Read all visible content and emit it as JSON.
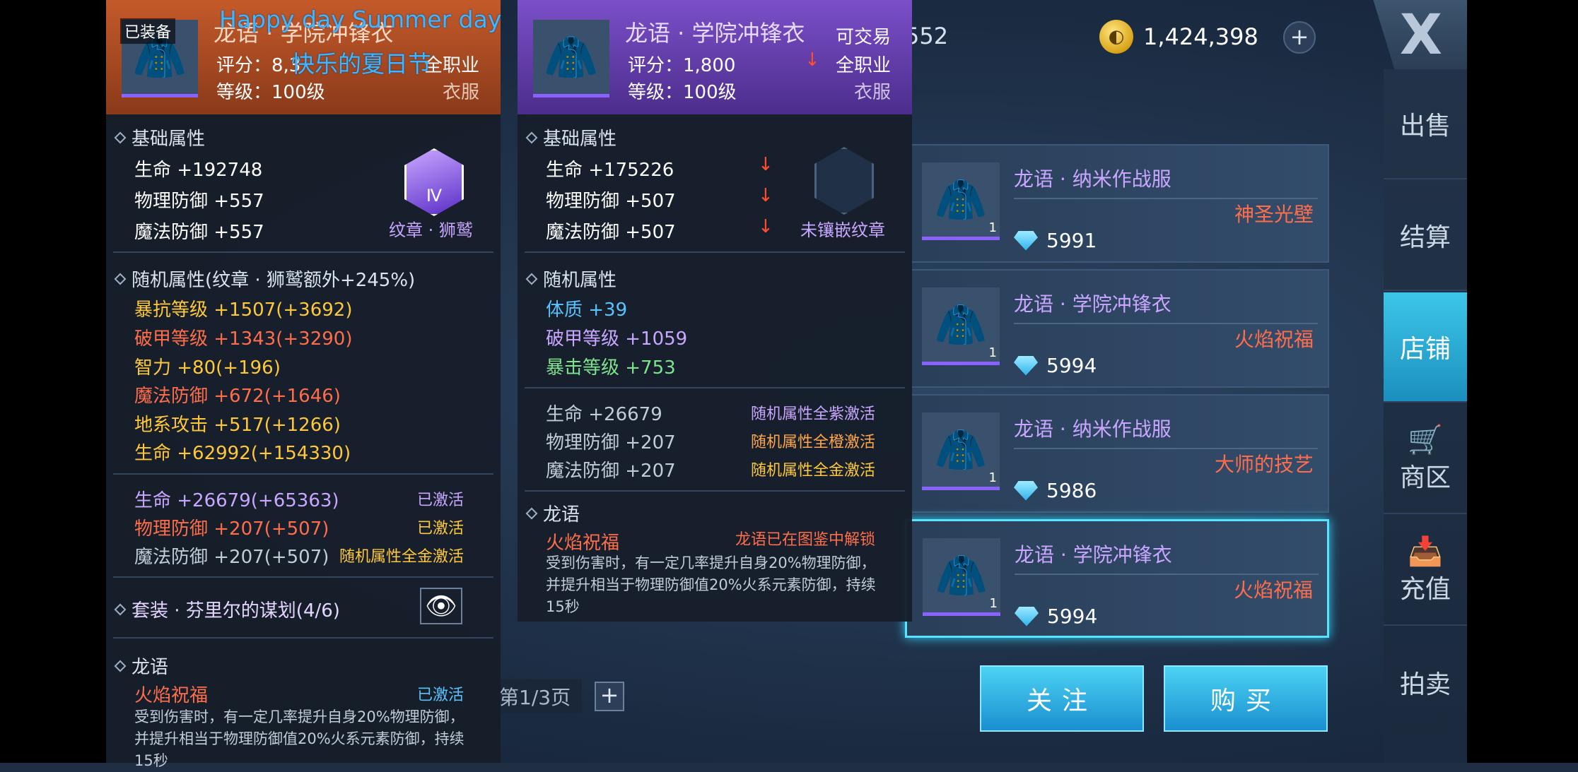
{
  "overlay": {
    "line1": "Happy day Summer day",
    "line2": "快乐的夏日节"
  },
  "topbar": {
    "partial_value": "552",
    "gold_value": "1,424,398",
    "plus": "+",
    "close": "X"
  },
  "nav": [
    {
      "label": "出售",
      "icon": ""
    },
    {
      "label": "结算",
      "icon": ""
    },
    {
      "label": "店铺",
      "icon": ""
    },
    {
      "label": "商区",
      "icon": "🛒"
    },
    {
      "label": "充值",
      "icon": "📥"
    },
    {
      "label": "拍卖",
      "icon": ""
    }
  ],
  "listings": [
    {
      "name": "龙语 · 纳米作战服",
      "attr": "神圣光壁",
      "price": "5991",
      "level": "1"
    },
    {
      "name": "龙语 · 学院冲锋衣",
      "attr": "火焰祝福",
      "price": "5994",
      "level": "1"
    },
    {
      "name": "龙语 · 纳米作战服",
      "attr": "大师的技艺",
      "price": "5986",
      "level": "1"
    },
    {
      "name": "龙语 · 学院冲锋衣",
      "attr": "火焰祝福",
      "price": "5994",
      "level": "1"
    }
  ],
  "buttons": {
    "follow": "关注",
    "buy": "购买"
  },
  "pager": {
    "text": "第1/3页",
    "plus": "+"
  },
  "left_panel": {
    "equipped_tag": "已装备",
    "name": "龙语 · 学院冲锋衣",
    "score": "评分：8,3",
    "profession": "全职业",
    "level": "等级：100级",
    "slot": "衣服",
    "basic_title": "基础属性",
    "basic": [
      "生命 +192748",
      "物理防御 +557",
      "魔法防御 +557"
    ],
    "emblem_label": "纹章 · 狮鹫",
    "emblem_mark": "Ⅳ",
    "random_title": "随机属性(纹章 · 狮鹫额外+245%)",
    "random": [
      {
        "text": "暴抗等级 +1507(+3692)",
        "color": "gold"
      },
      {
        "text": "破甲等级 +1343(+3290)",
        "color": "red"
      },
      {
        "text": "智力 +80(+196)",
        "color": "gold"
      },
      {
        "text": "魔法防御 +672(+1646)",
        "color": "red"
      },
      {
        "text": "地系攻击 +517(+1266)",
        "color": "gold"
      },
      {
        "text": "生命 +62992(+154330)",
        "color": "gold"
      }
    ],
    "bonus": [
      {
        "text": "生命 +26679(+65363)",
        "color": "purple",
        "status": "已激活",
        "status_color": "purple"
      },
      {
        "text": "物理防御 +207(+507)",
        "color": "red",
        "status": "已激活",
        "status_color": "gold"
      },
      {
        "text": "魔法防御 +207(+507)",
        "color": "grey",
        "status": "随机属性全金激活",
        "status_color": "gold"
      }
    ],
    "set_title": "套装 · 芬里尔的谋划(4/6)",
    "dragon_title": "龙语",
    "dragon_name": "火焰祝福",
    "dragon_status": "已激活",
    "dragon_desc": "受到伤害时，有一定几率提升自身20%物理防御，并提升相当于物理防御值20%火系元素防御，持续15秒"
  },
  "mid_panel": {
    "name": "龙语 · 学院冲锋衣",
    "tradable": "可交易",
    "score": "评分：1,800",
    "profession": "全职业",
    "level": "等级：100级",
    "slot": "衣服",
    "basic_title": "基础属性",
    "basic": [
      "生命 +175226",
      "物理防御 +507",
      "魔法防御 +507"
    ],
    "emblem_label": "未镶嵌纹章",
    "random_title": "随机属性",
    "random": [
      {
        "text": "体质 +39",
        "color": "blue"
      },
      {
        "text": "破甲等级 +1059",
        "color": "purple"
      },
      {
        "text": "暴击等级 +753",
        "color": "green"
      }
    ],
    "bonus": [
      {
        "text": "生命 +26679",
        "status": "随机属性全紫激活",
        "status_color": "purple"
      },
      {
        "text": "物理防御 +207",
        "status": "随机属性全橙激活",
        "status_color": "orange"
      },
      {
        "text": "魔法防御 +207",
        "status": "随机属性全金激活",
        "status_color": "gold"
      }
    ],
    "dragon_title": "龙语",
    "dragon_name": "火焰祝福",
    "dragon_status": "龙语已在图鉴中解锁",
    "dragon_desc": "受到伤害时，有一定几率提升自身20%物理防御，并提升相当于物理防御值20%火系元素防御，持续15秒"
  }
}
